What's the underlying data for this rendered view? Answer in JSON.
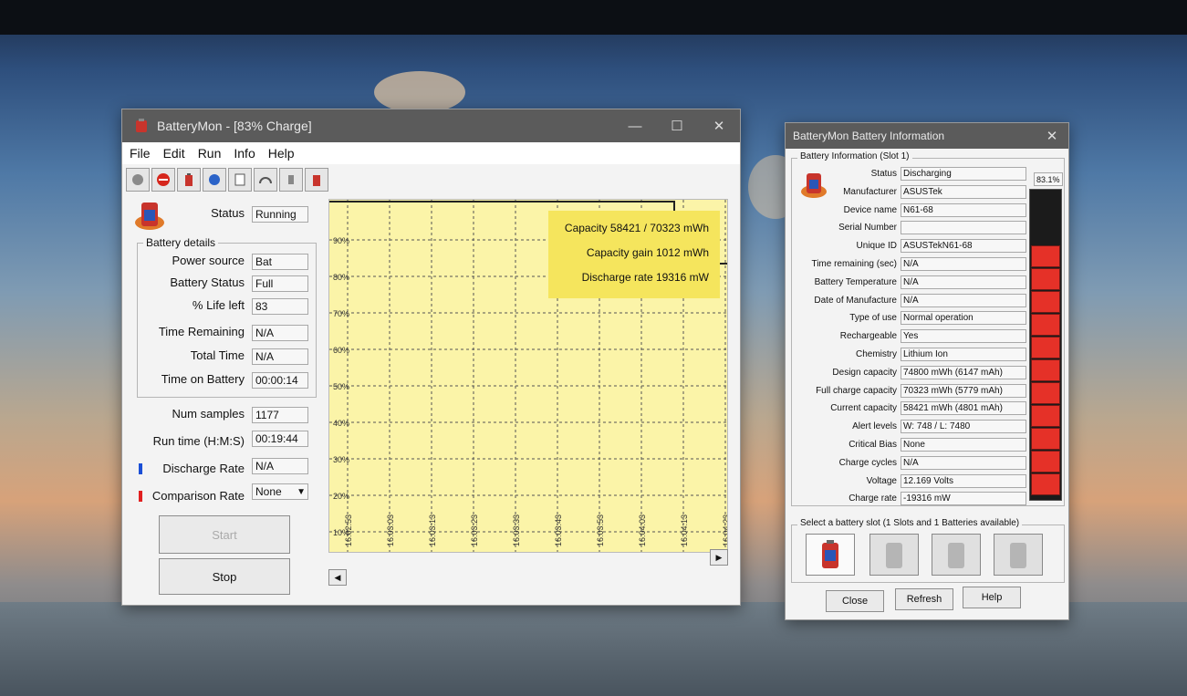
{
  "main": {
    "title": "BatteryMon - [83% Charge]",
    "menu": [
      "File",
      "Edit",
      "Run",
      "Info",
      "Help"
    ],
    "status_label": "Status",
    "status_value": "Running",
    "details": {
      "title": "Battery details",
      "power_source_label": "Power source",
      "power_source": "Bat",
      "battery_status_label": "Battery Status",
      "battery_status": "Full",
      "life_left_label": "% Life left",
      "life_left": "83",
      "time_remaining_label": "Time Remaining",
      "time_remaining": "N/A",
      "total_time_label": "Total Time",
      "total_time": "N/A",
      "time_on_battery_label": "Time on Battery",
      "time_on_battery": "00:00:14"
    },
    "num_samples_label": "Num samples",
    "num_samples": "1177",
    "run_time_label": "Run time (H:M:S)",
    "run_time": "00:19:44",
    "discharge_rate_label": "Discharge Rate",
    "discharge_rate": "N/A",
    "comparison_rate_label": "Comparison Rate",
    "comparison_rate": "None",
    "start_label": "Start",
    "stop_label": "Stop",
    "colors": {
      "discharge": "#1a4fd6",
      "comparison": "#e12020"
    }
  },
  "chart_data": {
    "type": "line",
    "y_ticks": [
      "90%",
      "80%",
      "70%",
      "60%",
      "50%",
      "40%",
      "30%",
      "20%",
      "10%"
    ],
    "x_ticks": [
      "16:02:53",
      "16:03:03",
      "16:03:13",
      "16:03:23",
      "16:03:33",
      "16:03:43",
      "16:03:53",
      "16:04:03",
      "16:04:13",
      "16:04:23"
    ],
    "grid": true,
    "info": [
      "Capacity 58421 / 70323 mWh",
      "Capacity gain 1012 mWh",
      "Discharge rate 19316 mW"
    ]
  },
  "info_window": {
    "title": "BatteryMon Battery Information",
    "group_title": "Battery Information (Slot 1)",
    "fields": [
      {
        "label": "Status",
        "value": "Discharging"
      },
      {
        "label": "Manufacturer",
        "value": "ASUSTek"
      },
      {
        "label": "Device name",
        "value": "N61-68"
      },
      {
        "label": "Serial Number",
        "value": ""
      },
      {
        "label": "Unique ID",
        "value": "ASUSTekN61-68"
      },
      {
        "label": "Time remaining (sec)",
        "value": "N/A"
      },
      {
        "label": "Battery Temperature",
        "value": "N/A"
      },
      {
        "label": "Date of Manufacture",
        "value": "N/A"
      },
      {
        "label": "Type of use",
        "value": "Normal operation"
      },
      {
        "label": "Rechargeable",
        "value": "Yes"
      },
      {
        "label": "Chemistry",
        "value": "Lithium Ion"
      },
      {
        "label": "Design capacity",
        "value": "74800 mWh (6147 mAh)"
      },
      {
        "label": "Full charge capacity",
        "value": "70323 mWh (5779 mAh)"
      },
      {
        "label": "Current capacity",
        "value": "58421 mWh (4801 mAh)"
      },
      {
        "label": "Alert levels",
        "value": "W: 748 / L: 7480"
      },
      {
        "label": "Critical Bias",
        "value": "None"
      },
      {
        "label": "Charge cycles",
        "value": "N/A"
      },
      {
        "label": "Voltage",
        "value": "12.169 Volts"
      },
      {
        "label": "Charge rate",
        "value": "-19316 mW"
      }
    ],
    "charge_percent": "83.1%",
    "charge_level": 0.831,
    "slots_title": "Select a battery slot (1 Slots and 1 Batteries available)",
    "close_label": "Close",
    "refresh_label": "Refresh",
    "help_label": "Help"
  }
}
